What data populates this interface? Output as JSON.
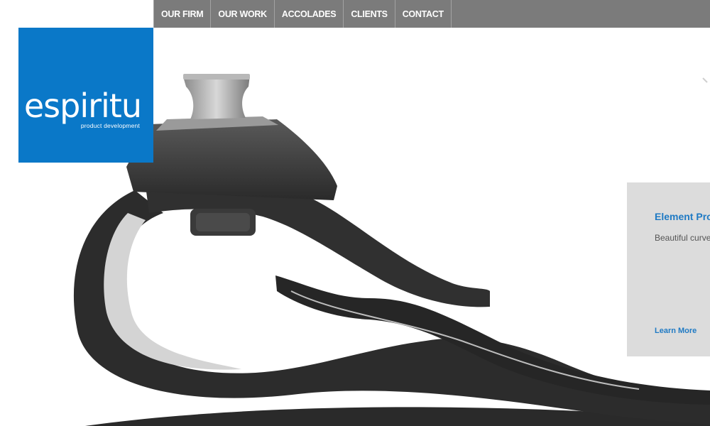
{
  "nav": {
    "items": [
      {
        "label": "OUR FIRM"
      },
      {
        "label": "OUR WORK"
      },
      {
        "label": "ACCOLADES"
      },
      {
        "label": "CLIENTS"
      },
      {
        "label": "CONTACT"
      }
    ]
  },
  "logo": {
    "wordmark": "espiritu",
    "tagline": "product development",
    "color": "#0a78c8"
  },
  "feature": {
    "title": "Element Pro",
    "description": "Beautiful curve function bring full swing...",
    "link_label": "Learn More"
  },
  "colors": {
    "nav_bg": "#7b7b7b",
    "accent": "#1f7ac4",
    "card_bg": "#dcdcdc"
  }
}
